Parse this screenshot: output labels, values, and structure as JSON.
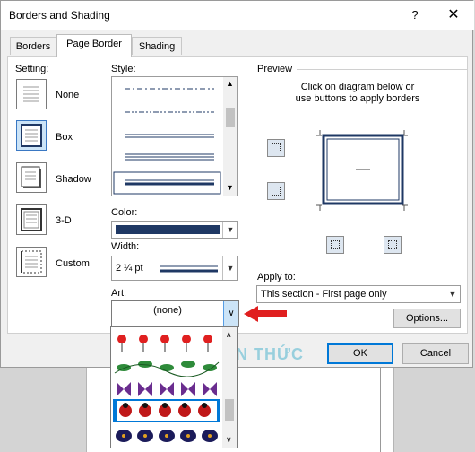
{
  "title": "Borders and Shading",
  "title_help": "?",
  "title_close": "✕",
  "tabs": [
    "Borders",
    "Page Border",
    "Shading"
  ],
  "setting": {
    "label": "Setting:",
    "options": [
      "None",
      "Box",
      "Shadow",
      "3-D",
      "Custom"
    ],
    "selected": "Box"
  },
  "style": {
    "label": "Style:"
  },
  "color": {
    "label": "Color:",
    "value_color": "#1f3864"
  },
  "width": {
    "label": "Width:",
    "value": "2 ¼ pt"
  },
  "art": {
    "label": "Art:",
    "value": "(none)",
    "open": true
  },
  "preview": {
    "label": "Preview",
    "instruction_line1": "Click on diagram below or",
    "instruction_line2": "use buttons to apply borders"
  },
  "apply_to": {
    "label": "Apply to:",
    "value": "This section - First page only"
  },
  "buttons": {
    "options": "Options...",
    "ok": "OK",
    "cancel": "Cancel"
  },
  "art_list_icons": [
    "balloons",
    "leaves",
    "butterflies",
    "ladybugs",
    "fish"
  ],
  "watermark": "NHÀ SẺ KIẾN THỨC",
  "colors": {
    "accent": "#0078d7",
    "arrow": "#e01f1f",
    "border_color": "#1f3864"
  }
}
